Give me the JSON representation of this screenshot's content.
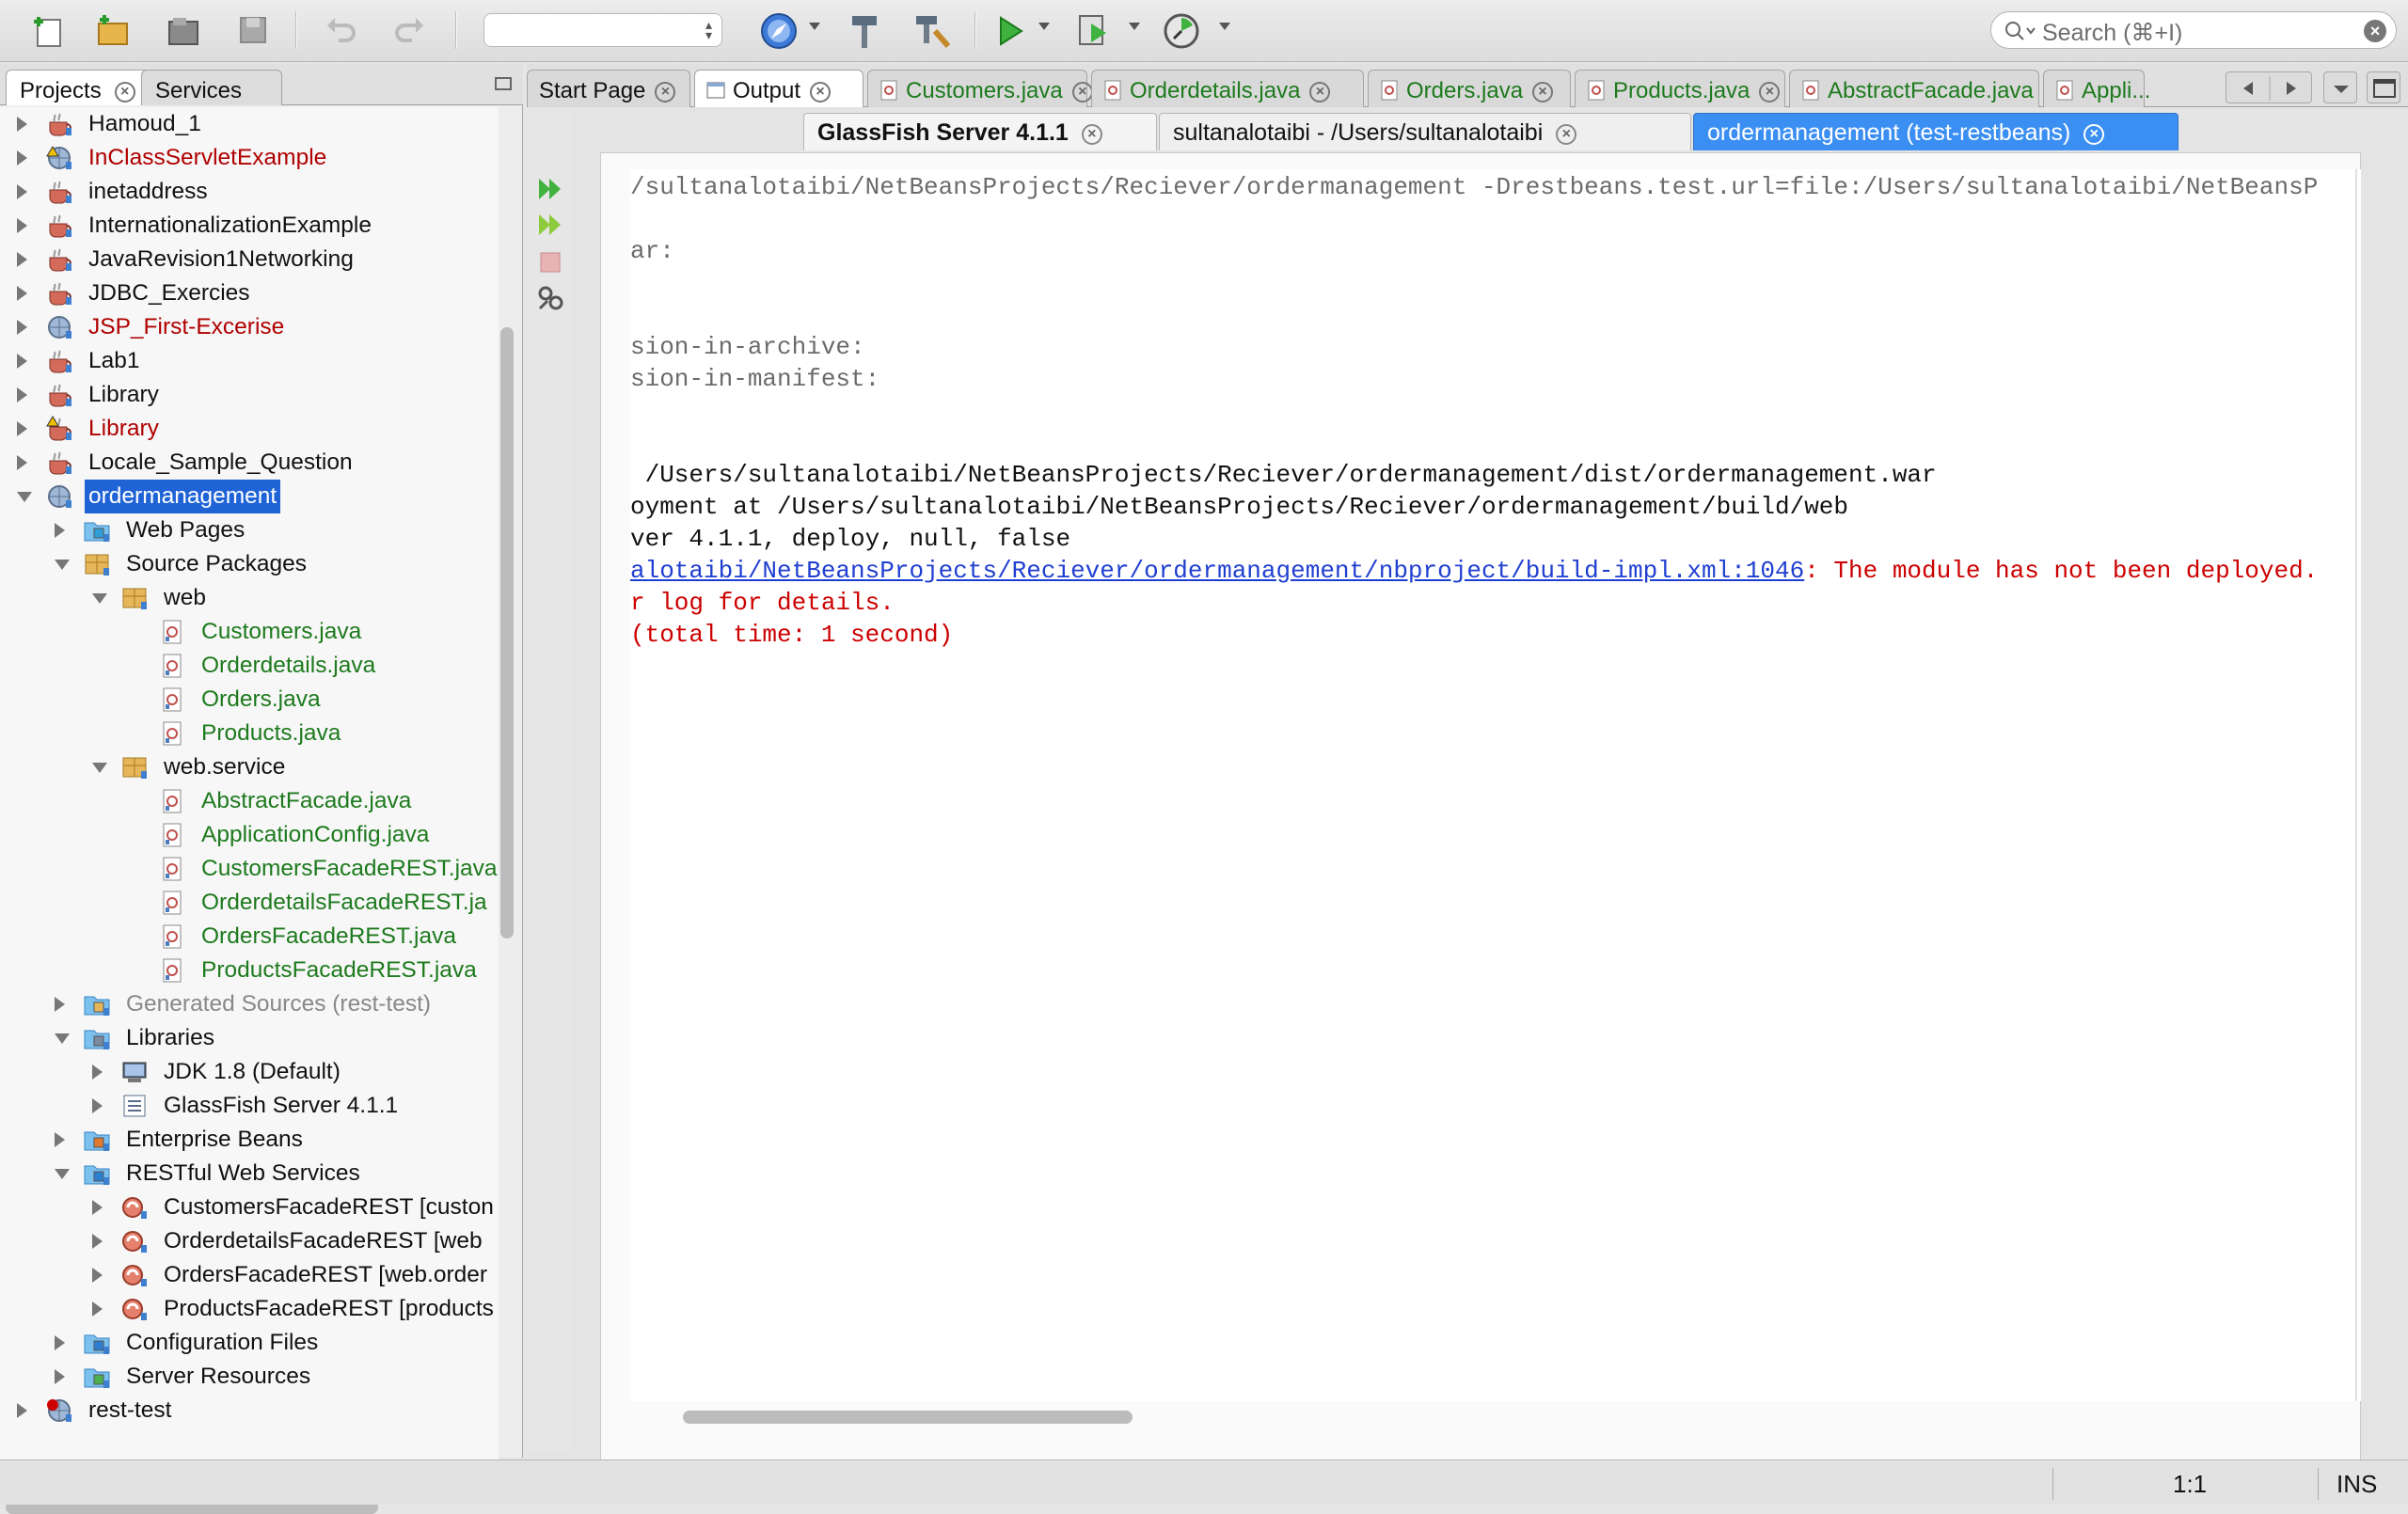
{
  "toolbar": {
    "buttons": [
      {
        "name": "new-file-icon"
      },
      {
        "name": "new-project-icon"
      },
      {
        "name": "open-project-icon"
      },
      {
        "name": "save-all-icon"
      },
      {
        "name": "undo-icon"
      },
      {
        "name": "redo-icon"
      },
      {
        "name": "browser-icon"
      },
      {
        "name": "build-hammer-icon"
      },
      {
        "name": "clean-build-icon"
      },
      {
        "name": "run-icon"
      },
      {
        "name": "debug-icon"
      },
      {
        "name": "profile-icon"
      }
    ],
    "config_value": "",
    "search_placeholder": "Search (⌘+I)"
  },
  "left_panel": {
    "tabs": [
      {
        "label": "Projects",
        "active": true
      },
      {
        "label": "Services",
        "active": false
      }
    ],
    "tree": [
      {
        "label": "Hamoud_1",
        "depth": 0,
        "state": "collapsed",
        "color": "black",
        "icon": "java-project-icon"
      },
      {
        "label": "InClassServletExample",
        "depth": 0,
        "state": "collapsed",
        "color": "red",
        "icon": "web-project-warning-icon"
      },
      {
        "label": "inetaddress",
        "depth": 0,
        "state": "collapsed",
        "color": "black",
        "icon": "java-project-icon"
      },
      {
        "label": "InternationalizationExample",
        "depth": 0,
        "state": "collapsed",
        "color": "black",
        "icon": "java-project-icon"
      },
      {
        "label": "JavaRevision1Networking",
        "depth": 0,
        "state": "collapsed",
        "color": "black",
        "icon": "java-project-icon"
      },
      {
        "label": "JDBC_Exercies",
        "depth": 0,
        "state": "collapsed",
        "color": "black",
        "icon": "java-project-icon"
      },
      {
        "label": "JSP_First-Excerise",
        "depth": 0,
        "state": "collapsed",
        "color": "red",
        "icon": "web-project-icon"
      },
      {
        "label": "Lab1",
        "depth": 0,
        "state": "collapsed",
        "color": "black",
        "icon": "java-project-icon"
      },
      {
        "label": "Library",
        "depth": 0,
        "state": "collapsed",
        "color": "black",
        "icon": "java-project-icon"
      },
      {
        "label": "Library",
        "depth": 0,
        "state": "collapsed",
        "color": "red",
        "icon": "java-project-warning-icon"
      },
      {
        "label": "Locale_Sample_Question",
        "depth": 0,
        "state": "collapsed",
        "color": "black",
        "icon": "java-project-icon"
      },
      {
        "label": "ordermanagement",
        "depth": 0,
        "state": "expanded",
        "color": "black",
        "icon": "web-project-icon",
        "selected": true
      },
      {
        "label": "Web Pages",
        "depth": 1,
        "state": "collapsed",
        "color": "black",
        "icon": "web-pages-folder-icon"
      },
      {
        "label": "Source Packages",
        "depth": 1,
        "state": "expanded",
        "color": "black",
        "icon": "source-packages-icon"
      },
      {
        "label": "web",
        "depth": 2,
        "state": "expanded",
        "color": "black",
        "icon": "package-icon"
      },
      {
        "label": "Customers.java",
        "depth": 3,
        "state": "none",
        "color": "green",
        "icon": "java-file-icon"
      },
      {
        "label": "Orderdetails.java",
        "depth": 3,
        "state": "none",
        "color": "green",
        "icon": "java-file-icon"
      },
      {
        "label": "Orders.java",
        "depth": 3,
        "state": "none",
        "color": "green",
        "icon": "java-file-icon"
      },
      {
        "label": "Products.java",
        "depth": 3,
        "state": "none",
        "color": "green",
        "icon": "java-file-icon"
      },
      {
        "label": "web.service",
        "depth": 2,
        "state": "expanded",
        "color": "black",
        "icon": "package-icon"
      },
      {
        "label": "AbstractFacade.java",
        "depth": 3,
        "state": "none",
        "color": "green",
        "icon": "java-file-icon"
      },
      {
        "label": "ApplicationConfig.java",
        "depth": 3,
        "state": "none",
        "color": "green",
        "icon": "java-file-icon"
      },
      {
        "label": "CustomersFacadeREST.java",
        "depth": 3,
        "state": "none",
        "color": "green",
        "icon": "java-file-icon"
      },
      {
        "label": "OrderdetailsFacadeREST.ja",
        "depth": 3,
        "state": "none",
        "color": "green",
        "icon": "java-file-icon"
      },
      {
        "label": "OrdersFacadeREST.java",
        "depth": 3,
        "state": "none",
        "color": "green",
        "icon": "java-file-icon"
      },
      {
        "label": "ProductsFacadeREST.java",
        "depth": 3,
        "state": "none",
        "color": "green",
        "icon": "java-file-icon"
      },
      {
        "label": "Generated Sources (rest-test)",
        "depth": 1,
        "state": "collapsed",
        "color": "gray",
        "icon": "generated-sources-icon"
      },
      {
        "label": "Libraries",
        "depth": 1,
        "state": "expanded",
        "color": "black",
        "icon": "libraries-icon"
      },
      {
        "label": "JDK 1.8 (Default)",
        "depth": 2,
        "state": "collapsed",
        "color": "black",
        "icon": "jdk-icon"
      },
      {
        "label": "GlassFish Server 4.1.1",
        "depth": 2,
        "state": "collapsed",
        "color": "black",
        "icon": "server-library-icon"
      },
      {
        "label": "Enterprise Beans",
        "depth": 1,
        "state": "collapsed",
        "color": "black",
        "icon": "enterprise-beans-icon"
      },
      {
        "label": "RESTful Web Services",
        "depth": 1,
        "state": "expanded",
        "color": "black",
        "icon": "rest-services-icon"
      },
      {
        "label": "CustomersFacadeREST [custon",
        "depth": 2,
        "state": "collapsed",
        "color": "black",
        "icon": "rest-resource-icon"
      },
      {
        "label": "OrderdetailsFacadeREST [web",
        "depth": 2,
        "state": "collapsed",
        "color": "black",
        "icon": "rest-resource-icon"
      },
      {
        "label": "OrdersFacadeREST [web.order",
        "depth": 2,
        "state": "collapsed",
        "color": "black",
        "icon": "rest-resource-icon"
      },
      {
        "label": "ProductsFacadeREST [products",
        "depth": 2,
        "state": "collapsed",
        "color": "black",
        "icon": "rest-resource-icon"
      },
      {
        "label": "Configuration Files",
        "depth": 1,
        "state": "collapsed",
        "color": "black",
        "icon": "config-files-icon"
      },
      {
        "label": "Server Resources",
        "depth": 1,
        "state": "collapsed",
        "color": "black",
        "icon": "server-resources-icon"
      },
      {
        "label": "rest-test",
        "depth": 0,
        "state": "collapsed",
        "color": "black",
        "icon": "web-project-error-icon"
      }
    ]
  },
  "editor": {
    "tabs": [
      {
        "label": "Start Page",
        "type": "plain",
        "active": false
      },
      {
        "label": "Output",
        "type": "output",
        "active": true
      },
      {
        "label": "Customers.java",
        "type": "java",
        "active": false
      },
      {
        "label": "Orderdetails.java",
        "type": "java",
        "active": false
      },
      {
        "label": "Orders.java",
        "type": "java",
        "active": false
      },
      {
        "label": "Products.java",
        "type": "java",
        "active": false
      },
      {
        "label": "AbstractFacade.java",
        "type": "java",
        "active": false
      },
      {
        "label": "Appli...",
        "type": "java-truncated",
        "active": false
      }
    ],
    "output_subtabs": [
      {
        "label": "GlassFish Server 4.1.1",
        "style": "bold"
      },
      {
        "label": "sultanalotaibi - /Users/sultanalotaibi",
        "style": "normal"
      },
      {
        "label": "ordermanagement (test-restbeans)",
        "style": "active"
      }
    ],
    "output_lines": [
      {
        "text": "/sultanalotaibi/NetBeansProjects/Reciever/ordermanagement -Drestbeans.test.url=file:/Users/sultanalotaibi/NetBeansP",
        "style": "gray"
      },
      {
        "text": "",
        "style": "gray"
      },
      {
        "text": "ar:",
        "style": "gray"
      },
      {
        "text": "",
        "style": "gray"
      },
      {
        "text": "",
        "style": "gray"
      },
      {
        "text": "sion-in-archive:",
        "style": "gray"
      },
      {
        "text": "sion-in-manifest:",
        "style": "gray"
      },
      {
        "text": "",
        "style": "gray"
      },
      {
        "text": "",
        "style": "gray"
      },
      {
        "text": " /Users/sultanalotaibi/NetBeansProjects/Reciever/ordermanagement/dist/ordermanagement.war",
        "style": "black"
      },
      {
        "text": "oyment at /Users/sultanalotaibi/NetBeansProjects/Reciever/ordermanagement/build/web",
        "style": "black"
      },
      {
        "text": "ver 4.1.1, deploy, null, false",
        "style": "black"
      },
      {
        "link": "alotaibi/NetBeansProjects/Reciever/ordermanagement/nbproject/build-impl.xml:1046",
        "text": ": The module has not been deployed.",
        "style": "link"
      },
      {
        "text": "r log for details.",
        "style": "red"
      },
      {
        "text": "(total time: 1 second)",
        "style": "red"
      }
    ]
  },
  "status": {
    "position": "1:1",
    "mode": "INS"
  }
}
